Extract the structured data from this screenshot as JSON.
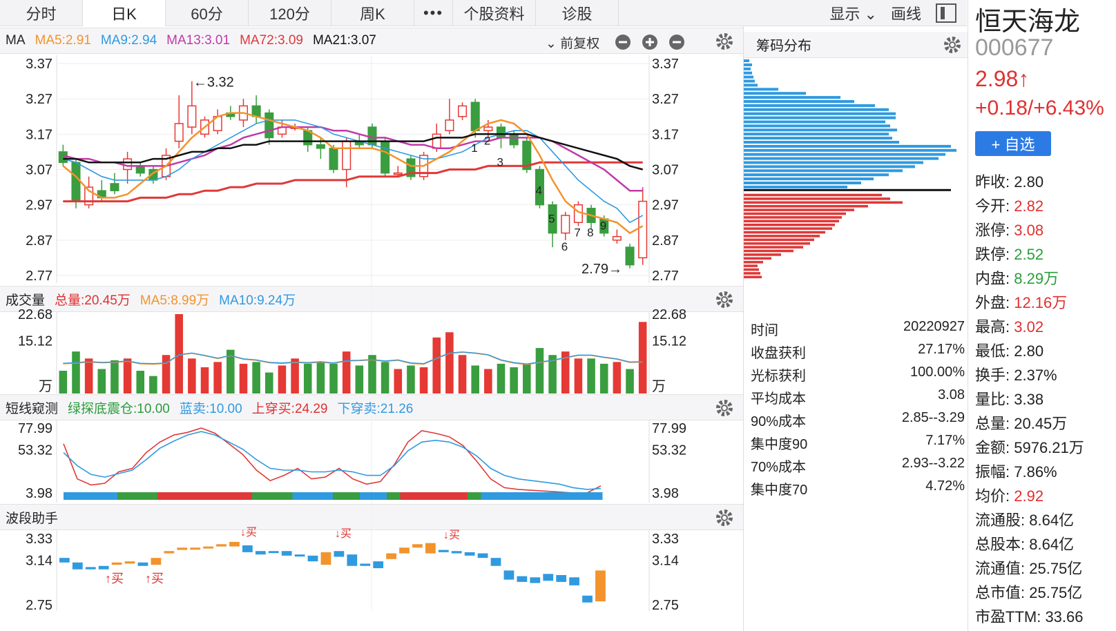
{
  "tabs": [
    "分时",
    "日K",
    "60分",
    "120分",
    "周K",
    "•••",
    "个股资料",
    "诊股"
  ],
  "toolbar": {
    "display_label": "显示",
    "draw_label": "画线"
  },
  "ma_header": {
    "title": "MA",
    "ma5": "MA5:2.91",
    "ma9": "MA9:2.94",
    "ma13": "MA13:3.01",
    "ma72": "MA72:3.09",
    "ma21": "MA21:3.07",
    "adjust": "前复权"
  },
  "colors": {
    "up": "#e53935",
    "down": "#3a9d3f",
    "ma5": "#f2932c",
    "ma9": "#2f9ae0",
    "ma13": "#c03aa8",
    "ma72": "#e03838",
    "ma21": "#111111",
    "blue_bar": "#2f9ae0",
    "orange_bar": "#f2932c"
  },
  "price_axis": [
    "3.37",
    "3.27",
    "3.17",
    "3.07",
    "2.97",
    "2.87",
    "2.77"
  ],
  "annotations": {
    "high": "←3.32",
    "low": "2.79→",
    "nums": [
      "1",
      "2",
      "3",
      "4",
      "5",
      "6",
      "7",
      "8",
      "9"
    ]
  },
  "volume_header": {
    "title": "成交量",
    "total": "总量:20.45万",
    "ma5": "MA5:8.99万",
    "ma10": "MA10:9.24万"
  },
  "volume_axis": [
    "22.68",
    "15.12",
    "万"
  ],
  "short_header": {
    "title": "短线窥测",
    "green": "绿探底震仓:10.00",
    "blue": "蓝卖:10.00",
    "up": "上穿买:24.29",
    "down": "下穿卖:21.26"
  },
  "short_axis": [
    "77.99",
    "53.32",
    "3.98"
  ],
  "wave_header": {
    "title": "波段助手"
  },
  "wave_axis": [
    "3.33",
    "3.14",
    "2.75"
  ],
  "wave_labels": {
    "buy": "买",
    "buy_arrow": "↑买",
    "buy_down": "↓买"
  },
  "chips": {
    "title": "筹码分布",
    "rows": [
      {
        "k": "时间",
        "v": "20220927"
      },
      {
        "k": "收盘获利",
        "v": "27.17%"
      },
      {
        "k": "光标获利",
        "v": "100.00%"
      },
      {
        "k": "平均成本",
        "v": "3.08"
      },
      {
        "k": "90%成本",
        "v": "2.85--3.29"
      },
      {
        "k": "集中度90",
        "v": "7.17%"
      },
      {
        "k": "70%成本",
        "v": "2.93--3.22"
      },
      {
        "k": "集中度70",
        "v": "4.72%"
      }
    ]
  },
  "stock": {
    "name": "恒天海龙",
    "code": "000677",
    "price": "2.98↑",
    "change": "+0.18/+6.43%",
    "add_btn": "+ 自选",
    "stats": [
      {
        "k": "昨收:",
        "v": "2.80",
        "c": ""
      },
      {
        "k": "今开:",
        "v": "2.82",
        "c": "red"
      },
      {
        "k": "涨停:",
        "v": "3.08",
        "c": "red"
      },
      {
        "k": "跌停:",
        "v": "2.52",
        "c": "green"
      },
      {
        "k": "内盘:",
        "v": "8.29万",
        "c": "green"
      },
      {
        "k": "外盘:",
        "v": "12.16万",
        "c": "red"
      },
      {
        "k": "最高:",
        "v": "3.02",
        "c": "red"
      },
      {
        "k": "最低:",
        "v": "2.80",
        "c": ""
      },
      {
        "k": "换手:",
        "v": "2.37%",
        "c": ""
      },
      {
        "k": "量比:",
        "v": "3.38",
        "c": ""
      },
      {
        "k": "总量:",
        "v": "20.45万",
        "c": ""
      },
      {
        "k": "金额:",
        "v": "5976.21万",
        "c": ""
      },
      {
        "k": "振幅:",
        "v": "7.86%",
        "c": ""
      },
      {
        "k": "均价:",
        "v": "2.92",
        "c": "red"
      },
      {
        "k": "流通股:",
        "v": "8.64亿",
        "c": ""
      },
      {
        "k": "总股本:",
        "v": "8.64亿",
        "c": ""
      },
      {
        "k": "流通值:",
        "v": "25.75亿",
        "c": ""
      },
      {
        "k": "总市值:",
        "v": "25.75亿",
        "c": ""
      },
      {
        "k": "市盈TTM:",
        "v": "33.66",
        "c": ""
      }
    ]
  },
  "chart_data": {
    "type": "candlestick",
    "ylim": [
      2.77,
      3.37
    ],
    "candles": [
      {
        "o": 3.12,
        "c": 3.09,
        "h": 3.14,
        "l": 3.08
      },
      {
        "o": 3.09,
        "c": 2.98,
        "h": 3.1,
        "l": 2.96
      },
      {
        "o": 2.97,
        "c": 3.02,
        "h": 3.05,
        "l": 2.96
      },
      {
        "o": 3.01,
        "c": 2.99,
        "h": 3.04,
        "l": 2.98
      },
      {
        "o": 3.03,
        "c": 3.01,
        "h": 3.06,
        "l": 3.0
      },
      {
        "o": 3.07,
        "c": 3.1,
        "h": 3.12,
        "l": 3.03
      },
      {
        "o": 3.08,
        "c": 3.06,
        "h": 3.09,
        "l": 3.05
      },
      {
        "o": 3.07,
        "c": 3.04,
        "h": 3.08,
        "l": 3.03
      },
      {
        "o": 3.05,
        "c": 3.11,
        "h": 3.13,
        "l": 3.04
      },
      {
        "o": 3.15,
        "c": 3.2,
        "h": 3.28,
        "l": 3.13
      },
      {
        "o": 3.19,
        "c": 3.25,
        "h": 3.32,
        "l": 3.17
      },
      {
        "o": 3.17,
        "c": 3.21,
        "h": 3.22,
        "l": 3.16
      },
      {
        "o": 3.18,
        "c": 3.22,
        "h": 3.24,
        "l": 3.17
      },
      {
        "o": 3.23,
        "c": 3.22,
        "h": 3.25,
        "l": 3.21
      },
      {
        "o": 3.21,
        "c": 3.25,
        "h": 3.27,
        "l": 3.19
      },
      {
        "o": 3.25,
        "c": 3.22,
        "h": 3.28,
        "l": 3.2
      },
      {
        "o": 3.23,
        "c": 3.16,
        "h": 3.24,
        "l": 3.14
      },
      {
        "o": 3.17,
        "c": 3.19,
        "h": 3.21,
        "l": 3.16
      },
      {
        "o": 3.19,
        "c": 3.19,
        "h": 3.2,
        "l": 3.18
      },
      {
        "o": 3.18,
        "c": 3.14,
        "h": 3.19,
        "l": 3.12
      },
      {
        "o": 3.14,
        "c": 3.13,
        "h": 3.16,
        "l": 3.1
      },
      {
        "o": 3.13,
        "c": 3.07,
        "h": 3.14,
        "l": 3.06
      },
      {
        "o": 3.07,
        "c": 3.15,
        "h": 3.16,
        "l": 3.02
      },
      {
        "o": 3.15,
        "c": 3.14,
        "h": 3.17,
        "l": 3.13
      },
      {
        "o": 3.19,
        "c": 3.14,
        "h": 3.2,
        "l": 3.13
      },
      {
        "o": 3.15,
        "c": 3.06,
        "h": 3.16,
        "l": 3.05
      },
      {
        "o": 3.06,
        "c": 3.06,
        "h": 3.08,
        "l": 3.05
      },
      {
        "o": 3.1,
        "c": 3.05,
        "h": 3.11,
        "l": 3.04
      },
      {
        "o": 3.05,
        "c": 3.11,
        "h": 3.12,
        "l": 3.04
      },
      {
        "o": 3.13,
        "c": 3.17,
        "h": 3.2,
        "l": 3.12
      },
      {
        "o": 3.18,
        "c": 3.21,
        "h": 3.27,
        "l": 3.17
      },
      {
        "o": 3.22,
        "c": 3.25,
        "h": 3.26,
        "l": 3.21
      },
      {
        "o": 3.26,
        "c": 3.18,
        "h": 3.27,
        "l": 3.16
      },
      {
        "o": 3.18,
        "c": 3.19,
        "h": 3.21,
        "l": 3.16
      },
      {
        "o": 3.19,
        "c": 3.16,
        "h": 3.2,
        "l": 3.13
      },
      {
        "o": 3.17,
        "c": 3.14,
        "h": 3.18,
        "l": 3.13
      },
      {
        "o": 3.15,
        "c": 3.07,
        "h": 3.16,
        "l": 3.06
      },
      {
        "o": 3.07,
        "c": 2.97,
        "h": 3.08,
        "l": 2.96
      },
      {
        "o": 2.97,
        "c": 2.89,
        "h": 2.98,
        "l": 2.85
      },
      {
        "o": 2.89,
        "c": 2.94,
        "h": 2.95,
        "l": 2.87
      },
      {
        "o": 2.92,
        "c": 2.97,
        "h": 2.98,
        "l": 2.91
      },
      {
        "o": 2.96,
        "c": 2.92,
        "h": 2.97,
        "l": 2.9
      },
      {
        "o": 2.93,
        "c": 2.89,
        "h": 2.94,
        "l": 2.88
      },
      {
        "o": 2.87,
        "c": 2.88,
        "h": 2.9,
        "l": 2.86
      },
      {
        "o": 2.85,
        "c": 2.8,
        "h": 2.86,
        "l": 2.79
      },
      {
        "o": 2.82,
        "c": 2.98,
        "h": 3.02,
        "l": 2.8
      }
    ],
    "ma5": [
      3.08,
      3.05,
      3.01,
      2.99,
      2.99,
      3.0,
      3.03,
      3.06,
      3.08,
      3.12,
      3.16,
      3.19,
      3.22,
      3.23,
      3.23,
      3.22,
      3.21,
      3.2,
      3.19,
      3.18,
      3.16,
      3.13,
      3.13,
      3.13,
      3.13,
      3.12,
      3.1,
      3.08,
      3.08,
      3.1,
      3.12,
      3.15,
      3.18,
      3.2,
      3.21,
      3.2,
      3.17,
      3.11,
      3.04,
      2.98,
      2.95,
      2.94,
      2.93,
      2.92,
      2.89,
      2.91
    ],
    "ma9": [
      3.1,
      3.09,
      3.07,
      3.05,
      3.04,
      3.04,
      3.04,
      3.04,
      3.05,
      3.07,
      3.1,
      3.12,
      3.14,
      3.16,
      3.18,
      3.2,
      3.21,
      3.21,
      3.21,
      3.2,
      3.19,
      3.17,
      3.16,
      3.15,
      3.14,
      3.13,
      3.12,
      3.11,
      3.1,
      3.1,
      3.11,
      3.12,
      3.14,
      3.16,
      3.17,
      3.18,
      3.18,
      3.16,
      3.12,
      3.08,
      3.04,
      3.01,
      2.98,
      2.96,
      2.92,
      2.94
    ],
    "ma13": [
      3.11,
      3.1,
      3.1,
      3.09,
      3.09,
      3.08,
      3.08,
      3.08,
      3.08,
      3.09,
      3.1,
      3.11,
      3.13,
      3.14,
      3.16,
      3.17,
      3.18,
      3.19,
      3.19,
      3.19,
      3.19,
      3.18,
      3.18,
      3.17,
      3.16,
      3.16,
      3.15,
      3.14,
      3.14,
      3.13,
      3.13,
      3.14,
      3.15,
      3.15,
      3.16,
      3.16,
      3.16,
      3.16,
      3.15,
      3.13,
      3.11,
      3.09,
      3.07,
      3.04,
      3.01,
      3.01
    ],
    "ma21": [
      3.1,
      3.1,
      3.09,
      3.09,
      3.09,
      3.09,
      3.09,
      3.1,
      3.1,
      3.11,
      3.12,
      3.12,
      3.13,
      3.13,
      3.14,
      3.14,
      3.15,
      3.15,
      3.15,
      3.15,
      3.15,
      3.15,
      3.15,
      3.15,
      3.15,
      3.15,
      3.15,
      3.15,
      3.15,
      3.16,
      3.16,
      3.16,
      3.17,
      3.17,
      3.17,
      3.17,
      3.17,
      3.16,
      3.15,
      3.14,
      3.13,
      3.12,
      3.11,
      3.1,
      3.08,
      3.07
    ],
    "ma72": [
      2.98,
      2.98,
      2.98,
      2.98,
      2.98,
      2.98,
      2.99,
      2.99,
      2.99,
      3.0,
      3.0,
      3.01,
      3.01,
      3.02,
      3.02,
      3.03,
      3.03,
      3.03,
      3.04,
      3.04,
      3.04,
      3.04,
      3.04,
      3.05,
      3.05,
      3.05,
      3.05,
      3.06,
      3.06,
      3.06,
      3.07,
      3.07,
      3.07,
      3.08,
      3.08,
      3.08,
      3.08,
      3.09,
      3.09,
      3.09,
      3.09,
      3.09,
      3.09,
      3.09,
      3.09,
      3.09
    ],
    "volume": [
      6.5,
      12,
      10,
      7,
      9.5,
      10,
      6.5,
      5,
      11,
      22.68,
      10,
      7.5,
      9,
      12.5,
      8.5,
      9,
      6,
      8,
      10,
      8.5,
      9,
      8.5,
      12,
      8,
      11,
      9,
      7,
      8,
      7.5,
      16,
      17.5,
      11,
      8,
      7,
      8.5,
      7.5,
      8.5,
      13,
      11,
      12,
      10,
      10,
      8.5,
      9,
      7,
      20.45
    ],
    "vol_ma": [
      8.5,
      8.7,
      9.0,
      8.8,
      8.9,
      9.2,
      8.5,
      8.4,
      8.6,
      11,
      11.5,
      10.8,
      10,
      10.8,
      9.8,
      9.5,
      8.8,
      8.6,
      8.9,
      8.7,
      9,
      8.6,
      9.3,
      9.4,
      9.6,
      9.2,
      9.5,
      8.6,
      8.4,
      10,
      11.5,
      11.8,
      11.5,
      11,
      9.5,
      8.7,
      8.3,
      8.9,
      9.4,
      10.2,
      10.9,
      10.9,
      10.3,
      9.8,
      8.9,
      8.99
    ],
    "short_red": [
      60,
      20,
      13,
      15,
      28,
      32,
      50,
      62,
      70,
      73,
      77.99,
      72,
      60,
      48,
      30,
      18,
      24,
      32,
      20,
      22,
      32,
      20,
      14,
      17,
      36,
      62,
      75,
      72,
      68,
      58,
      40,
      20,
      10,
      8,
      7,
      6,
      5,
      4,
      3.98,
      12
    ],
    "short_blue": [
      50,
      35,
      25,
      22,
      26,
      30,
      42,
      55,
      63,
      70,
      74,
      70,
      62,
      54,
      42,
      32,
      30,
      30,
      28,
      28,
      30,
      28,
      24,
      24,
      35,
      52,
      62,
      64,
      62,
      56,
      46,
      32,
      24,
      20,
      18,
      16,
      14,
      10,
      8,
      9
    ],
    "short_colors": [
      "blue",
      "blue",
      "blue",
      "blue",
      "green",
      "green",
      "green",
      "red",
      "red",
      "red",
      "red",
      "red",
      "red",
      "red",
      "green",
      "green",
      "green",
      "blue",
      "blue",
      "blue",
      "green",
      "green",
      "blue",
      "blue",
      "green",
      "red",
      "red",
      "red",
      "red",
      "red",
      "green",
      "blue",
      "blue",
      "blue",
      "blue",
      "blue",
      "blue",
      "blue",
      "blue",
      "blue"
    ],
    "wave": [
      {
        "top": 3.16,
        "bot": 3.12,
        "c": "b"
      },
      {
        "top": 3.12,
        "bot": 3.06,
        "c": "b"
      },
      {
        "top": 3.08,
        "bot": 3.06,
        "c": "b"
      },
      {
        "top": 3.09,
        "bot": 3.06,
        "c": "b"
      },
      {
        "top": 3.12,
        "bot": 3.1,
        "c": "o"
      },
      {
        "top": 3.13,
        "bot": 3.11,
        "c": "o"
      },
      {
        "top": 3.12,
        "bot": 3.09,
        "c": "b"
      },
      {
        "top": 3.16,
        "bot": 3.1,
        "c": "o"
      },
      {
        "top": 3.22,
        "bot": 3.2,
        "c": "o"
      },
      {
        "top": 3.25,
        "bot": 3.23,
        "c": "o"
      },
      {
        "top": 3.25,
        "bot": 3.24,
        "c": "o"
      },
      {
        "top": 3.26,
        "bot": 3.25,
        "c": "o"
      },
      {
        "top": 3.28,
        "bot": 3.26,
        "c": "o"
      },
      {
        "top": 3.3,
        "bot": 3.26,
        "c": "o"
      },
      {
        "top": 3.27,
        "bot": 3.21,
        "c": "b"
      },
      {
        "top": 3.22,
        "bot": 3.19,
        "c": "b"
      },
      {
        "top": 3.22,
        "bot": 3.21,
        "c": "b"
      },
      {
        "top": 3.22,
        "bot": 3.18,
        "c": "b"
      },
      {
        "top": 3.19,
        "bot": 3.18,
        "c": "b"
      },
      {
        "top": 3.18,
        "bot": 3.13,
        "c": "b"
      },
      {
        "top": 3.21,
        "bot": 3.1,
        "c": "o"
      },
      {
        "top": 3.22,
        "bot": 3.17,
        "c": "b"
      },
      {
        "top": 3.19,
        "bot": 3.09,
        "c": "b"
      },
      {
        "top": 3.11,
        "bot": 3.09,
        "c": "b"
      },
      {
        "top": 3.13,
        "bot": 3.07,
        "c": "b"
      },
      {
        "top": 3.2,
        "bot": 3.15,
        "c": "o"
      },
      {
        "top": 3.25,
        "bot": 3.2,
        "c": "o"
      },
      {
        "top": 3.28,
        "bot": 3.25,
        "c": "o"
      },
      {
        "top": 3.29,
        "bot": 3.2,
        "c": "o"
      },
      {
        "top": 3.23,
        "bot": 3.21,
        "c": "b"
      },
      {
        "top": 3.22,
        "bot": 3.2,
        "c": "b"
      },
      {
        "top": 3.21,
        "bot": 3.18,
        "c": "b"
      },
      {
        "top": 3.2,
        "bot": 3.16,
        "c": "b"
      },
      {
        "top": 3.16,
        "bot": 3.09,
        "c": "b"
      },
      {
        "top": 3.05,
        "bot": 2.97,
        "c": "b"
      },
      {
        "top": 3.0,
        "bot": 2.95,
        "c": "b"
      },
      {
        "top": 2.99,
        "bot": 2.94,
        "c": "b"
      },
      {
        "top": 3.02,
        "bot": 2.96,
        "c": "b"
      },
      {
        "top": 3.01,
        "bot": 2.95,
        "c": "b"
      },
      {
        "top": 2.99,
        "bot": 2.92,
        "c": "b"
      },
      {
        "top": 2.83,
        "bot": 2.77,
        "c": "b"
      },
      {
        "top": 3.05,
        "bot": 2.78,
        "c": "o"
      }
    ],
    "chips_blue": [
      8,
      12,
      10,
      12,
      14,
      16,
      20,
      50,
      90,
      140,
      160,
      190,
      210,
      220,
      220,
      205,
      212,
      222,
      210,
      215,
      225,
      300,
      308,
      292,
      282,
      260,
      248,
      230,
      210,
      188,
      170,
      150
    ],
    "chips_red": [
      200,
      212,
      230,
      180,
      160,
      148,
      142,
      138,
      132,
      128,
      118,
      110,
      102,
      96,
      86,
      72,
      54,
      40,
      28,
      20,
      22,
      24,
      26
    ]
  }
}
